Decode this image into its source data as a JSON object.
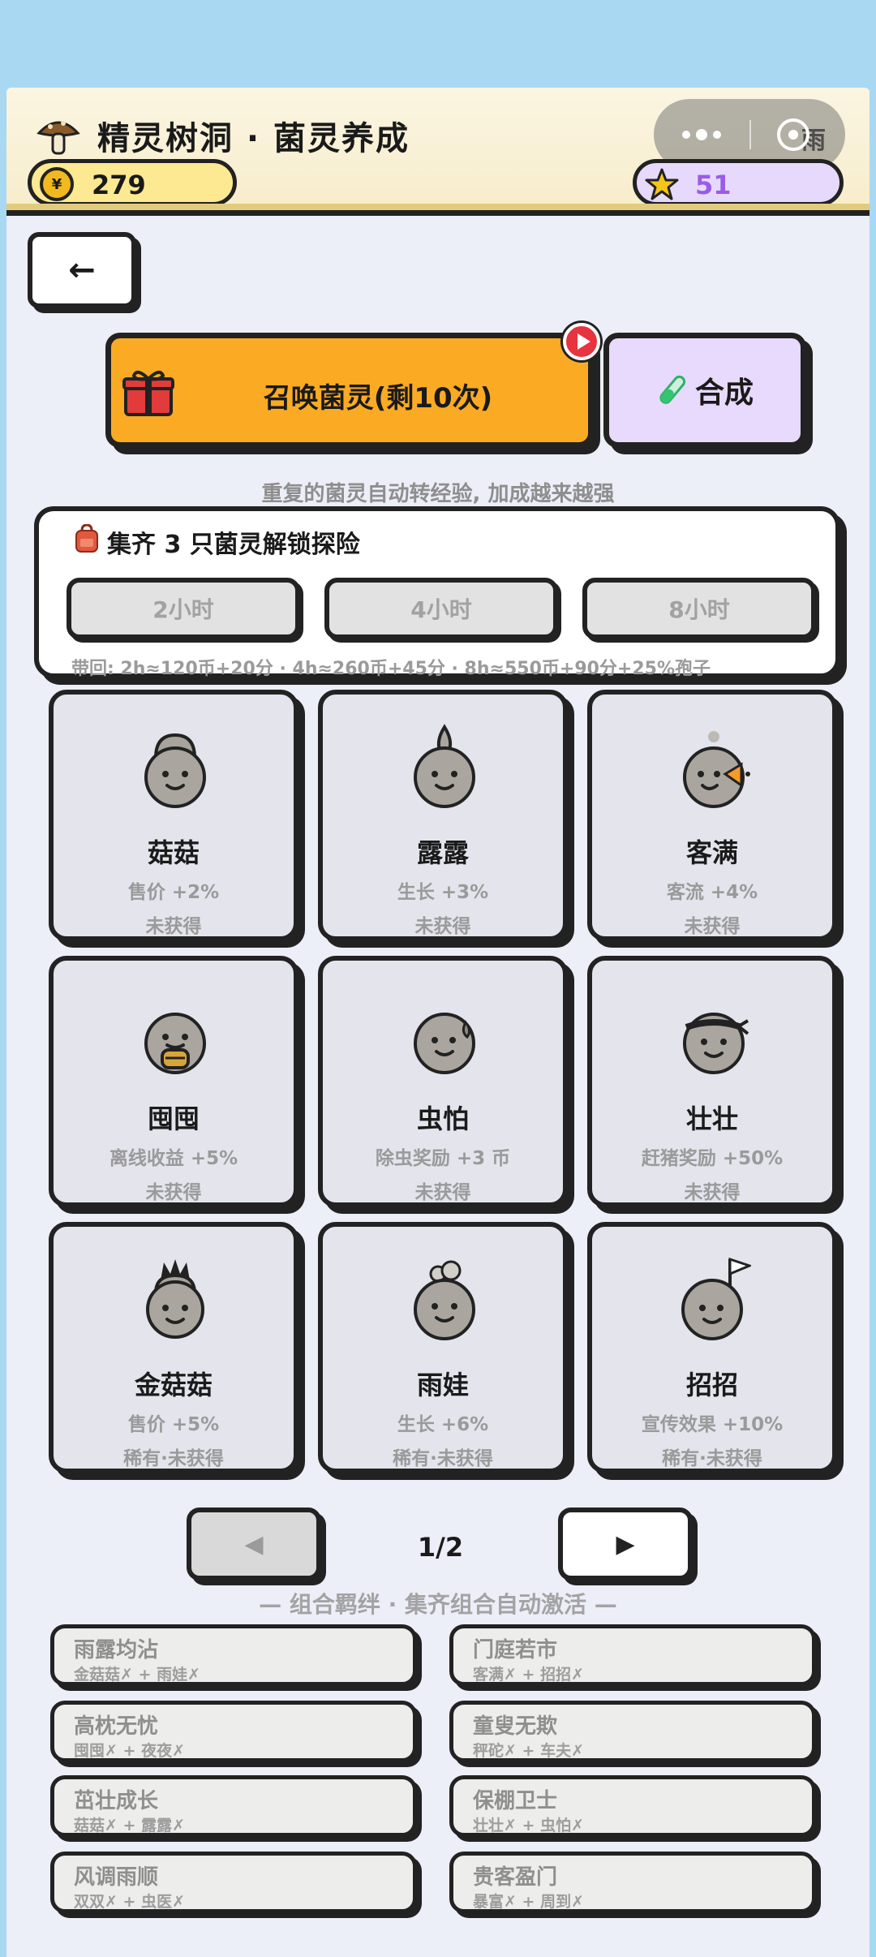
{
  "header": {
    "title": "精灵树洞 · 菌灵养成",
    "coins": "279",
    "coin_symbol": "¥",
    "stars": "51",
    "weather": "雨"
  },
  "back_arrow": "←",
  "summon": {
    "label": "召唤菌灵(剩10次)"
  },
  "merge": {
    "label": "合成"
  },
  "hint": "重复的菌灵自动转经验, 加成越来越强",
  "expedition": {
    "title": "集齐 3 只菌灵解锁探险",
    "durations": [
      "2小时",
      "4小时",
      "8小时"
    ],
    "note": "带回: 2h≈120币+20分 · 4h≈260币+45分 · 8h≈550币+90分+25%孢子"
  },
  "spirits": [
    {
      "name": "菇菇",
      "effect": "售价 +2%",
      "status": "未获得"
    },
    {
      "name": "露露",
      "effect": "生长 +3%",
      "status": "未获得"
    },
    {
      "name": "客满",
      "effect": "客流 +4%",
      "status": "未获得"
    },
    {
      "name": "囤囤",
      "effect": "离线收益 +5%",
      "status": "未获得"
    },
    {
      "name": "虫怕",
      "effect": "除虫奖励 +3 币",
      "status": "未获得"
    },
    {
      "name": "壮壮",
      "effect": "赶猪奖励 +50%",
      "status": "未获得"
    },
    {
      "name": "金菇菇",
      "effect": "售价 +5%",
      "status": "稀有·未获得"
    },
    {
      "name": "雨娃",
      "effect": "生长 +6%",
      "status": "稀有·未获得"
    },
    {
      "name": "招招",
      "effect": "宣传效果 +10%",
      "status": "稀有·未获得"
    }
  ],
  "pagination": {
    "prev": "◀",
    "next": "▶",
    "indicator": "1/2"
  },
  "combos_title": "— 组合羁绊 · 集齐组合自动激活 —",
  "combos": [
    {
      "name": "雨露均沾",
      "req": "金菇菇✗ + 雨娃✗"
    },
    {
      "name": "门庭若市",
      "req": "客满✗ + 招招✗"
    },
    {
      "name": "高枕无忧",
      "req": "囤囤✗ + 夜夜✗"
    },
    {
      "name": "童叟无欺",
      "req": "秤砣✗ + 车夫✗"
    },
    {
      "name": "茁壮成长",
      "req": "菇菇✗ + 露露✗"
    },
    {
      "name": "保棚卫士",
      "req": "壮壮✗ + 虫怕✗"
    },
    {
      "name": "风调雨顺",
      "req": "双双✗ + 虫医✗"
    },
    {
      "name": "贵客盈门",
      "req": "暴富✗ + 周到✗"
    }
  ],
  "colors": {
    "sky": "#a9d8f2",
    "summon": "#fbab23",
    "merge": "#e8dafc",
    "star_value": "#9a5be8",
    "card": "#e3e4ec"
  }
}
